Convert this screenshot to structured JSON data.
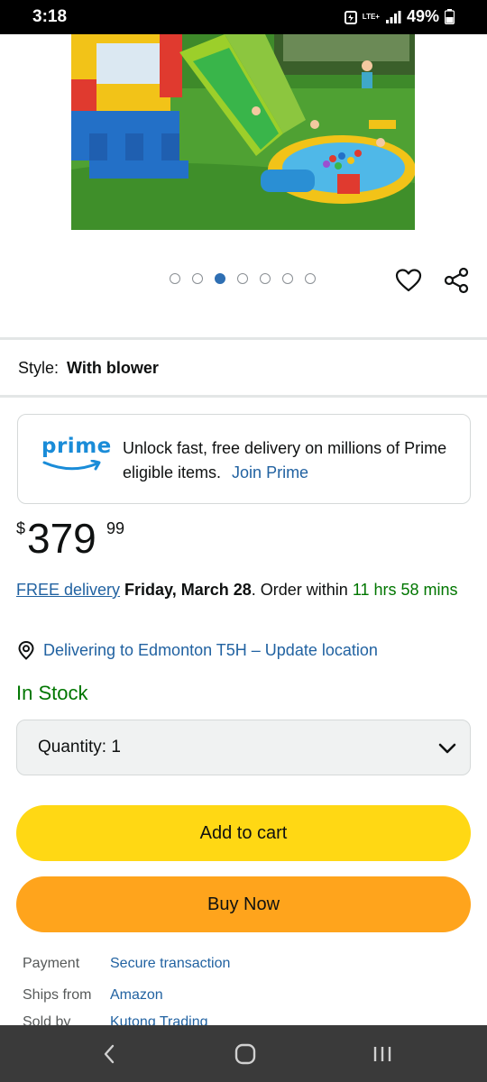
{
  "status_bar": {
    "time": "3:18",
    "network": "LTE+",
    "battery": "49%"
  },
  "gallery": {
    "image_count": 7,
    "active_index": 2
  },
  "style": {
    "label": "Style:",
    "value": "With blower"
  },
  "prime": {
    "logo_text": "prime",
    "message": "Unlock fast, free delivery on millions of Prime eligible items.",
    "join_label": "Join Prime"
  },
  "price": {
    "symbol": "$",
    "whole": "379",
    "fraction": "99"
  },
  "delivery": {
    "free_label": "FREE delivery",
    "date": "Friday, March 28",
    "order_within": ". Order within ",
    "countdown": "11 hrs 58 mins"
  },
  "location": {
    "text": "Delivering to Edmonton T5H – Update location"
  },
  "stock": {
    "status": "In Stock"
  },
  "quantity": {
    "label": "Quantity:",
    "value": "1"
  },
  "buttons": {
    "add_to_cart": "Add to cart",
    "buy_now": "Buy Now"
  },
  "details": [
    {
      "key": "Payment",
      "value": "Secure transaction"
    },
    {
      "key": "Ships from",
      "value": "Amazon"
    },
    {
      "key": "Sold by",
      "value": "Kutong Trading"
    }
  ],
  "colors": {
    "link": "#2162a1",
    "in_stock": "#007600",
    "add_to_cart": "#ffd814",
    "buy_now": "#ffa41c",
    "prime_blue": "#1a8cd8",
    "dot_active": "#2f6fb3"
  }
}
